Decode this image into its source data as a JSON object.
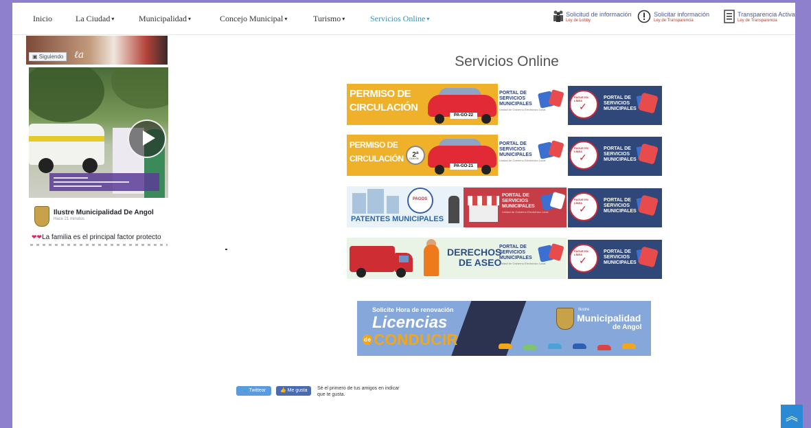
{
  "nav": {
    "items": [
      {
        "label": "Inicio",
        "caret": ""
      },
      {
        "label": "La Ciudad",
        "caret": "▾"
      },
      {
        "label": "Municipalidad",
        "caret": "▾"
      },
      {
        "label": "Concejo Municipal",
        "caret": "▾"
      },
      {
        "label": "Turismo",
        "caret": "▾"
      },
      {
        "label": "Servicios Online",
        "caret": "▾"
      }
    ],
    "top_links": [
      {
        "title": "Solicitud de información",
        "subtitle": "Ley de Lobby",
        "icon": "people-icon"
      },
      {
        "title": "Solicitar información",
        "subtitle": "Ley de Transparencia",
        "icon": "info-icon"
      },
      {
        "title": "Transparencia Activa",
        "subtitle": "Ley de Transparencia",
        "icon": "document-icon"
      }
    ]
  },
  "facebook": {
    "follow_label": "Siguiendo",
    "page_name": "Ilustre Municipalidad De Angol",
    "time": "Hace 21 minutos",
    "post_text": "La familia es el principal factor protecto"
  },
  "main": {
    "title": "Servicios Online",
    "banners": [
      {
        "name": "permiso-circulacion",
        "line1": "PERMISO DE",
        "line2": "CIRCULACIÓN",
        "plate": "PA-GO-22"
      },
      {
        "name": "permiso-circulacion-2",
        "line1": "PERMISO DE",
        "line2": "CIRCULACIÓN",
        "cuota": "2ª",
        "cuota_sub": "CUOTA",
        "plate": "PA-GO-21"
      },
      {
        "name": "patentes-municipales",
        "line1": "PATENTES MUNICIPALES",
        "seal": "PAGOS"
      },
      {
        "name": "derechos-aseo",
        "line1": "DERECHOS",
        "line2": "DE ASEO"
      }
    ],
    "portal": {
      "line1": "PORTAL DE",
      "line2": "SERVICIOS",
      "line3": "MUNICIPALES",
      "sub": "Unidad de Gobierno Electrónico Local",
      "seal_text": "PAGUE EN LÍNEA",
      "check": "✓"
    },
    "licencias": {
      "line1": "Solicite Hora de renovación",
      "line2": "Licencias",
      "de": "de",
      "line3": "CONDUCIR",
      "ilustre": "Ilustre",
      "muni": "Municipalidad",
      "angol": "de Angol"
    }
  },
  "social": {
    "tweet": "Twittear",
    "like": "Me gusta",
    "like_text": "Sé el primero de tus amigos en indicar que te gusta."
  },
  "scroll_top": "︽"
}
